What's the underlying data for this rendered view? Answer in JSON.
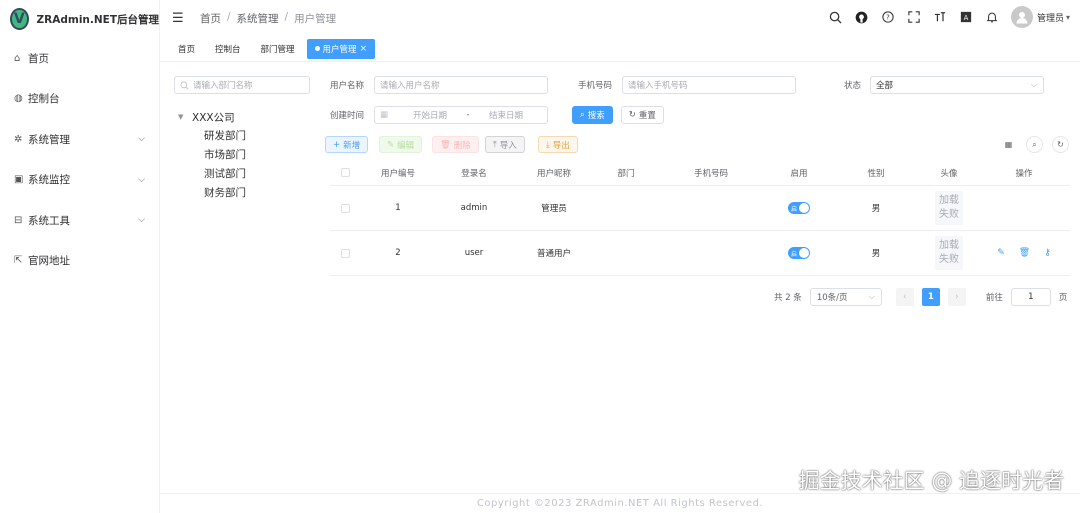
{
  "app": {
    "title": "ZRAdmin.NET后台管理",
    "logo_letter": "V"
  },
  "sidebar": {
    "items": [
      {
        "label": "首页",
        "icon": "home-icon",
        "glyph": "⌂",
        "expandable": false
      },
      {
        "label": "控制台",
        "icon": "dashboard-icon",
        "glyph": "◍",
        "expandable": false
      },
      {
        "label": "系统管理",
        "icon": "gear-icon",
        "glyph": "✲",
        "expandable": true
      },
      {
        "label": "系统监控",
        "icon": "monitor-icon",
        "glyph": "▣",
        "expandable": true
      },
      {
        "label": "系统工具",
        "icon": "toolbox-icon",
        "glyph": "⊟",
        "expandable": true
      },
      {
        "label": "官网地址",
        "icon": "external-link-icon",
        "glyph": "⇱",
        "expandable": false
      }
    ]
  },
  "header": {
    "breadcrumb": [
      "首页",
      "系统管理",
      "用户管理"
    ],
    "user_name": "管理员"
  },
  "tags": [
    {
      "label": "首页",
      "active": false
    },
    {
      "label": "控制台",
      "active": false
    },
    {
      "label": "部门管理",
      "active": false
    },
    {
      "label": "用户管理",
      "active": true
    }
  ],
  "dept": {
    "search_placeholder": "请输入部门名称",
    "root": "XXX公司",
    "children": [
      "研发部门",
      "市场部门",
      "测试部门",
      "财务部门"
    ]
  },
  "filters": {
    "username_label": "用户名称",
    "username_placeholder": "请输入用户名称",
    "phone_label": "手机号码",
    "phone_placeholder": "请输入手机号码",
    "status_label": "状态",
    "status_value": "全部",
    "created_label": "创建时间",
    "start_placeholder": "开始日期",
    "range_sep": "-",
    "end_placeholder": "结束日期",
    "search_button": "搜索",
    "reset_button": "重置"
  },
  "toolbar": {
    "add": "新增",
    "edit": "编辑",
    "delete": "删除",
    "import": "导入",
    "export": "导出"
  },
  "table": {
    "columns": [
      "用户编号",
      "登录名",
      "用户昵称",
      "部门",
      "手机号码",
      "启用",
      "性别",
      "头像",
      "操作"
    ],
    "rows": [
      {
        "id": "1",
        "login": "admin",
        "nickname": "管理员",
        "dept": "",
        "phone": "",
        "enabled_text": "启",
        "gender": "男",
        "avatar_line1": "加载",
        "avatar_line2": "失败",
        "has_ops": false
      },
      {
        "id": "2",
        "login": "user",
        "nickname": "普通用户",
        "dept": "",
        "phone": "",
        "enabled_text": "启",
        "gender": "男",
        "avatar_line1": "加载",
        "avatar_line2": "失败",
        "has_ops": true
      }
    ]
  },
  "pagination": {
    "total_text": "共 2 条",
    "page_size": "10条/页",
    "current_page": "1",
    "goto_label": "前往",
    "goto_value": "1",
    "page_suffix": "页"
  },
  "footer": {
    "copyright": "Copyright ©2023 ZRAdmin.NET All Rights Reserved."
  },
  "watermark": "掘金技术社区 @ 追逐时光者",
  "colors": {
    "primary": "#409eff",
    "success": "#67c23a",
    "danger": "#f56c6c",
    "warning": "#e6a23c",
    "info": "#909399"
  }
}
